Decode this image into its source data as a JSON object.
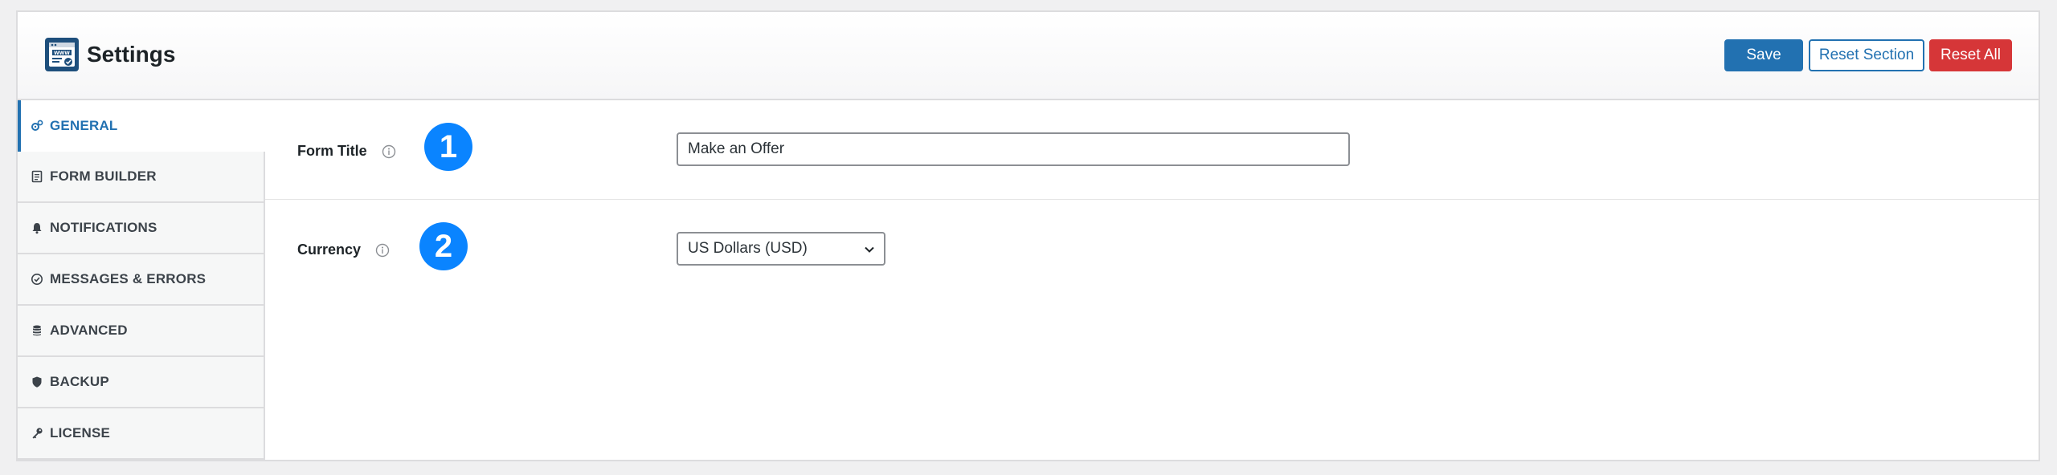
{
  "header": {
    "title": "Settings",
    "logo_text": "WWW",
    "buttons": {
      "save": "Save",
      "reset_section": "Reset Section",
      "reset_all": "Reset All"
    }
  },
  "sidebar": {
    "items": [
      {
        "label": "GENERAL",
        "icon": "gears-icon",
        "active": true
      },
      {
        "label": "FORM BUILDER",
        "icon": "document-icon",
        "active": false
      },
      {
        "label": "NOTIFICATIONS",
        "icon": "bell-icon",
        "active": false
      },
      {
        "label": "MESSAGES & ERRORS",
        "icon": "check-circle-icon",
        "active": false
      },
      {
        "label": "ADVANCED",
        "icon": "database-icon",
        "active": false
      },
      {
        "label": "BACKUP",
        "icon": "shield-icon",
        "active": false
      },
      {
        "label": "LICENSE",
        "icon": "key-icon",
        "active": false
      }
    ]
  },
  "fields": {
    "form_title": {
      "label": "Form Title",
      "value": "Make an Offer",
      "badge": "1",
      "icon": "info-icon"
    },
    "currency": {
      "label": "Currency",
      "selected": "US Dollars (USD)",
      "badge": "2",
      "icon": "info-icon"
    }
  },
  "colors": {
    "primary": "#2271b1",
    "danger": "#d63638",
    "badge": "#0a84ff",
    "logo": "#1e4f7c"
  }
}
